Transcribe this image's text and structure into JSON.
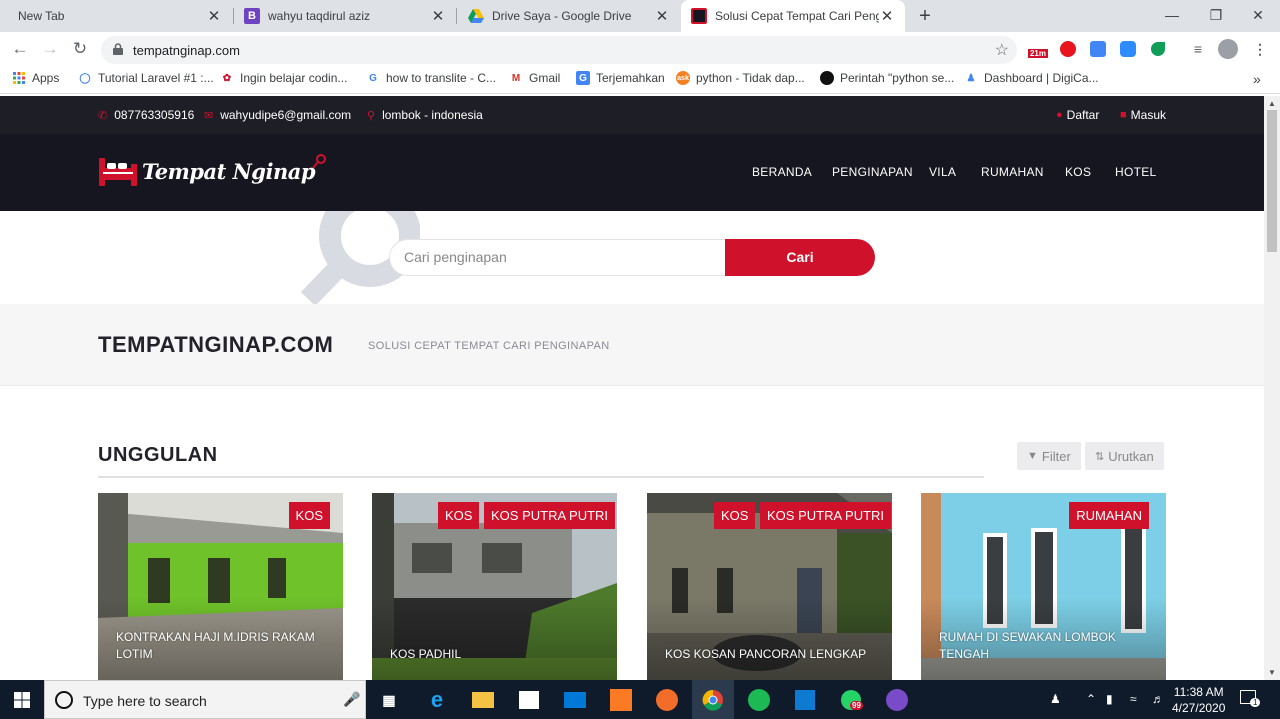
{
  "browser": {
    "tabs": [
      {
        "title": "New Tab"
      },
      {
        "title": "wahyu taqdirul aziz",
        "icon_letter": "B"
      },
      {
        "title": "Drive Saya - Google Drive"
      },
      {
        "title": "Solusi Cepat Tempat Cari Pengina"
      }
    ],
    "new_tab": "+",
    "close_glyph": "✕",
    "url": "tempatnginap.com",
    "ext_badge": "21m",
    "bookmarks": [
      {
        "label": "Apps"
      },
      {
        "label": "Tutorial Laravel #1 :..."
      },
      {
        "label": "Ingin belajar codin..."
      },
      {
        "label": "how to translite - C..."
      },
      {
        "label": "Gmail"
      },
      {
        "label": "Terjemahkan"
      },
      {
        "label": "python - Tidak dap..."
      },
      {
        "label": "Perintah \"python se..."
      },
      {
        "label": "Dashboard | DigiCa..."
      }
    ],
    "bookmarks_more": "»"
  },
  "site": {
    "contact": {
      "phone": "087763305916",
      "email": "wahyudipe6@gmail.com",
      "location": "lombok - indonesia"
    },
    "auth": {
      "register": "Daftar",
      "login": "Masuk"
    },
    "logo_text": "Tempat Nginap",
    "nav": [
      "BERANDA",
      "PENGINAPAN",
      "VILA",
      "RUMAHAN",
      "KOS",
      "HOTEL"
    ],
    "search": {
      "placeholder": "Cari penginapan",
      "button": "Cari"
    },
    "hero": {
      "title": "TEMPATNGINAP.COM",
      "subtitle": "SOLUSI CEPAT TEMPAT CARI PENGINAPAN"
    },
    "featured": {
      "heading": "UNGGULAN",
      "filter": "Filter",
      "sort": "Urutkan",
      "cards": [
        {
          "title": "KONTRAKAN HAJI M.IDRIS RAKAM LOTIM",
          "badges": [
            "KOS"
          ]
        },
        {
          "title": "KOS PADHIL",
          "badges": [
            "KOS",
            "KOS PUTRA PUTRI"
          ]
        },
        {
          "title": "KOS KOSAN PANCORAN LENGKAP",
          "badges": [
            "KOS",
            "KOS PUTRA PUTRI"
          ]
        },
        {
          "title": "RUMAH DI SEWAKAN LOMBOK TENGAH",
          "badges": [
            "RUMAHAN"
          ]
        }
      ]
    }
  },
  "colors": {
    "accent": "#d0112b",
    "dark": "#161620",
    "topbar": "#1e1e26"
  },
  "taskbar": {
    "search_placeholder": "Type here to search",
    "time": "11:38 AM",
    "date": "4/27/2020",
    "whatsapp_badge": "99",
    "notif_badge": "1"
  }
}
